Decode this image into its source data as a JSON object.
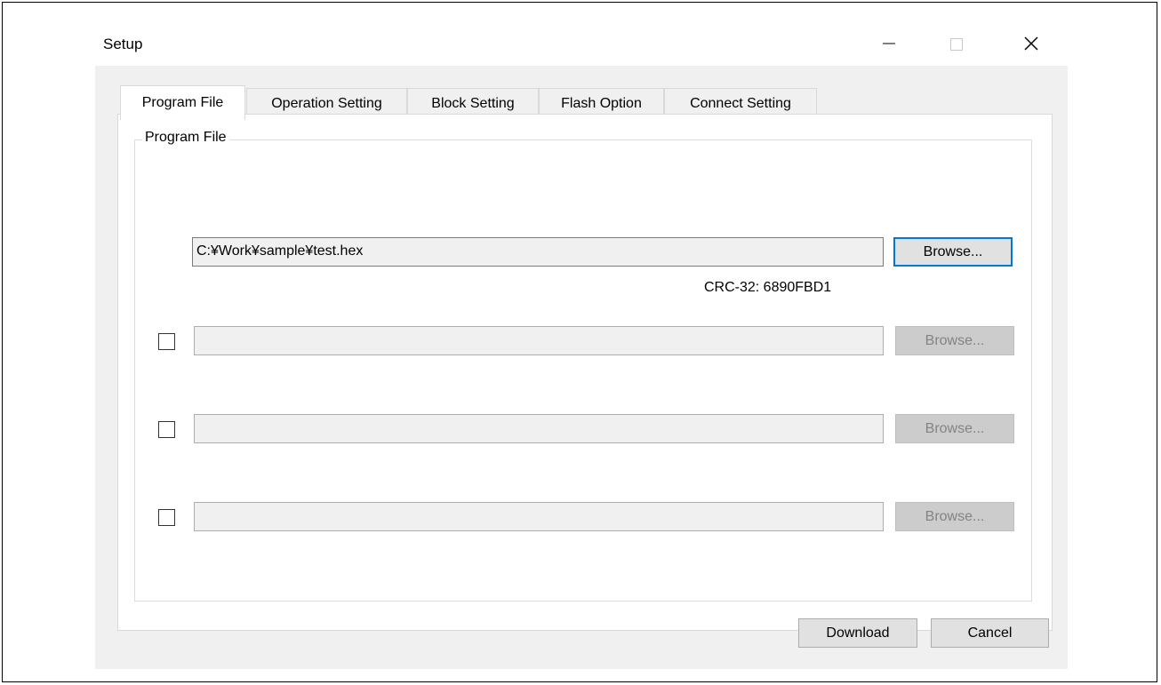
{
  "window": {
    "title": "Setup",
    "controls": {
      "minimize_icon": "minimize-icon",
      "maximize_icon": "maximize-icon",
      "close_icon": "close-icon"
    }
  },
  "tabs": [
    {
      "label": "Program File",
      "active": true
    },
    {
      "label": "Operation Setting",
      "active": false
    },
    {
      "label": "Block Setting",
      "active": false
    },
    {
      "label": "Flash Option",
      "active": false
    },
    {
      "label": "Connect Setting",
      "active": false
    }
  ],
  "program_file_group": {
    "legend": "Program File",
    "rows": [
      {
        "path": "C:¥Work¥sample¥test.hex",
        "browse_label": "Browse...",
        "crc": "CRC-32: 6890FBD1",
        "checked": null,
        "enabled": true
      },
      {
        "path": "",
        "browse_label": "Browse...",
        "checked": false,
        "enabled": false
      },
      {
        "path": "",
        "browse_label": "Browse...",
        "checked": false,
        "enabled": false
      },
      {
        "path": "",
        "browse_label": "Browse...",
        "checked": false,
        "enabled": false
      }
    ]
  },
  "footer": {
    "download_label": "Download",
    "cancel_label": "Cancel"
  },
  "colors": {
    "focus_border": "#0078d7",
    "dialog_background": "#f0f0f0",
    "disabled_text": "#838383"
  }
}
